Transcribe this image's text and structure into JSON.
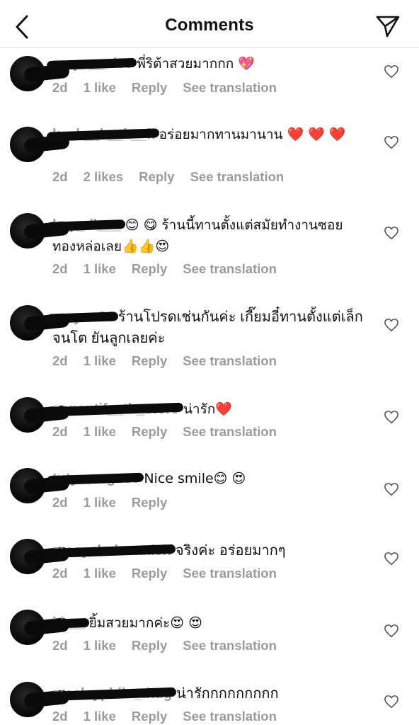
{
  "header": {
    "title": "Comments",
    "back_icon": "chevron-left-icon",
    "send_icon": "paper-plane-icon"
  },
  "colors": {
    "meta_gray": "#9b9b9b",
    "heart_red": "#e02130",
    "text": "#111111"
  },
  "comments": [
    {
      "username": "mayu__alee",
      "text": "พี่ริต้าสวยมากกก 💖",
      "time": "2d",
      "likes": "1 like",
      "reply": "Reply",
      "translation": "See translation"
    },
    {
      "username": "k__k__k__k__k",
      "text": "อร่อยมากทานมานาน ❤️ ❤️ ❤️",
      "time": "2d",
      "likes": "2 likes",
      "reply": "Reply",
      "translation": "See translation"
    },
    {
      "username": "kuy_dl___",
      "text": "😊 😋 ร้านนี้ทานตั้งแต่สมัยทำงานซอยทองหล่อเลย👍👍😍",
      "time": "2d",
      "likes": "1 like",
      "reply": "Reply",
      "translation": "See translation"
    },
    {
      "username": "arayan24",
      "text": "ร้านโปรดเช่นกันค่ะ เกี๊ยมอี๋ทานตั้งแต่เล็กจนโต ยันลูกเลยค่ะ",
      "time": "2d",
      "likes": "1 like",
      "reply": "Reply",
      "translation": "See translation"
    },
    {
      "username": "panantif__th_store",
      "text": "น่ารัก❤️",
      "time": "2d",
      "likes": "1 like",
      "reply": "Reply",
      "translation": "See translation"
    },
    {
      "username": "tutywongso5",
      "text": "Nice smile😊 😍",
      "time": "2d",
      "likes": "1 like",
      "reply": "Reply",
      "translation": ""
    },
    {
      "username": "moeycholavanich",
      "text": "จริงค่ะ อร่อยมากๆ",
      "time": "2d",
      "likes": "1 like",
      "reply": "Reply",
      "translation": "See translation"
    },
    {
      "username": "kh__",
      "text": "ยิ้มสวยมากค่ะ😍 😍",
      "time": "2d",
      "likes": "1 like",
      "reply": "Reply",
      "translation": "See translation"
    },
    {
      "username": "maalayphile_thug",
      "text": "น่ารักกกกกกกกก",
      "time": "2d",
      "likes": "1 like",
      "reply": "Reply",
      "translation": "See translation"
    }
  ]
}
